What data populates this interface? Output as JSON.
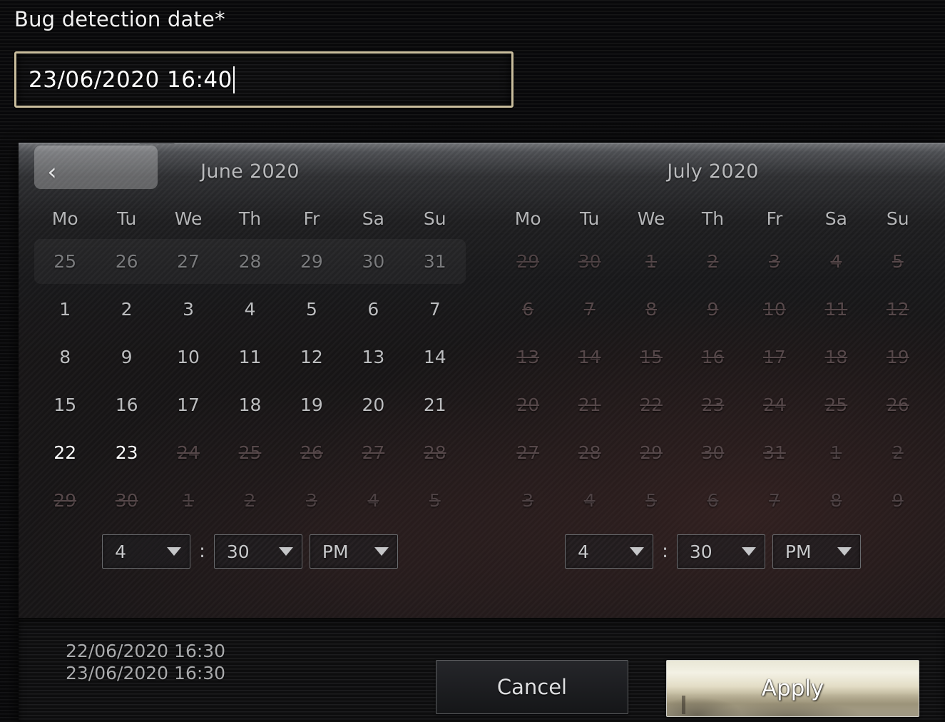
{
  "field": {
    "label": "Bug detection date*",
    "value": "23/06/2020 16:40"
  },
  "popup": {
    "prev_icon": "chevron-left-icon",
    "caret_icon": "chevron-up-icon",
    "months": [
      {
        "title": "June 2020",
        "weekdays": [
          "Mo",
          "Tu",
          "We",
          "Th",
          "Fr",
          "Sa",
          "Su"
        ],
        "weeks": [
          [
            {
              "d": "25",
              "state": "muted"
            },
            {
              "d": "26",
              "state": "muted"
            },
            {
              "d": "27",
              "state": "muted"
            },
            {
              "d": "28",
              "state": "muted"
            },
            {
              "d": "29",
              "state": "muted"
            },
            {
              "d": "30",
              "state": "muted"
            },
            {
              "d": "31",
              "state": "muted"
            }
          ],
          [
            {
              "d": "1",
              "state": "normal"
            },
            {
              "d": "2",
              "state": "normal"
            },
            {
              "d": "3",
              "state": "normal"
            },
            {
              "d": "4",
              "state": "normal"
            },
            {
              "d": "5",
              "state": "normal"
            },
            {
              "d": "6",
              "state": "normal"
            },
            {
              "d": "7",
              "state": "normal"
            }
          ],
          [
            {
              "d": "8",
              "state": "normal"
            },
            {
              "d": "9",
              "state": "normal"
            },
            {
              "d": "10",
              "state": "normal"
            },
            {
              "d": "11",
              "state": "normal"
            },
            {
              "d": "12",
              "state": "normal"
            },
            {
              "d": "13",
              "state": "normal"
            },
            {
              "d": "14",
              "state": "normal"
            }
          ],
          [
            {
              "d": "15",
              "state": "normal"
            },
            {
              "d": "16",
              "state": "normal"
            },
            {
              "d": "17",
              "state": "normal"
            },
            {
              "d": "18",
              "state": "normal"
            },
            {
              "d": "19",
              "state": "normal"
            },
            {
              "d": "20",
              "state": "normal"
            },
            {
              "d": "21",
              "state": "normal"
            }
          ],
          [
            {
              "d": "22",
              "state": "selected"
            },
            {
              "d": "23",
              "state": "selected"
            },
            {
              "d": "24",
              "state": "disabled"
            },
            {
              "d": "25",
              "state": "disabled"
            },
            {
              "d": "26",
              "state": "disabled"
            },
            {
              "d": "27",
              "state": "disabled"
            },
            {
              "d": "28",
              "state": "disabled"
            }
          ],
          [
            {
              "d": "29",
              "state": "disabled"
            },
            {
              "d": "30",
              "state": "disabled"
            },
            {
              "d": "1",
              "state": "muted-disabled"
            },
            {
              "d": "2",
              "state": "muted-disabled"
            },
            {
              "d": "3",
              "state": "muted-disabled"
            },
            {
              "d": "4",
              "state": "muted-disabled"
            },
            {
              "d": "5",
              "state": "muted-disabled"
            }
          ]
        ],
        "time": {
          "hour": "4",
          "separator": ":",
          "minute": "30",
          "period": "PM"
        }
      },
      {
        "title": "July 2020",
        "weekdays": [
          "Mo",
          "Tu",
          "We",
          "Th",
          "Fr",
          "Sa",
          "Su"
        ],
        "weeks": [
          [
            {
              "d": "29",
              "state": "muted-disabled"
            },
            {
              "d": "30",
              "state": "muted-disabled"
            },
            {
              "d": "1",
              "state": "disabled"
            },
            {
              "d": "2",
              "state": "disabled"
            },
            {
              "d": "3",
              "state": "disabled"
            },
            {
              "d": "4",
              "state": "disabled"
            },
            {
              "d": "5",
              "state": "disabled"
            }
          ],
          [
            {
              "d": "6",
              "state": "disabled"
            },
            {
              "d": "7",
              "state": "disabled"
            },
            {
              "d": "8",
              "state": "disabled"
            },
            {
              "d": "9",
              "state": "disabled"
            },
            {
              "d": "10",
              "state": "disabled"
            },
            {
              "d": "11",
              "state": "disabled"
            },
            {
              "d": "12",
              "state": "disabled"
            }
          ],
          [
            {
              "d": "13",
              "state": "disabled"
            },
            {
              "d": "14",
              "state": "disabled"
            },
            {
              "d": "15",
              "state": "disabled"
            },
            {
              "d": "16",
              "state": "disabled"
            },
            {
              "d": "17",
              "state": "disabled"
            },
            {
              "d": "18",
              "state": "disabled"
            },
            {
              "d": "19",
              "state": "disabled"
            }
          ],
          [
            {
              "d": "20",
              "state": "disabled"
            },
            {
              "d": "21",
              "state": "disabled"
            },
            {
              "d": "22",
              "state": "disabled"
            },
            {
              "d": "23",
              "state": "disabled"
            },
            {
              "d": "24",
              "state": "disabled"
            },
            {
              "d": "25",
              "state": "disabled"
            },
            {
              "d": "26",
              "state": "disabled"
            }
          ],
          [
            {
              "d": "27",
              "state": "disabled"
            },
            {
              "d": "28",
              "state": "disabled"
            },
            {
              "d": "29",
              "state": "disabled"
            },
            {
              "d": "30",
              "state": "disabled"
            },
            {
              "d": "31",
              "state": "disabled"
            },
            {
              "d": "1",
              "state": "muted-disabled"
            },
            {
              "d": "2",
              "state": "muted-disabled"
            }
          ],
          [
            {
              "d": "3",
              "state": "muted-disabled"
            },
            {
              "d": "4",
              "state": "muted-disabled"
            },
            {
              "d": "5",
              "state": "muted-disabled"
            },
            {
              "d": "6",
              "state": "muted-disabled"
            },
            {
              "d": "7",
              "state": "muted-disabled"
            },
            {
              "d": "8",
              "state": "muted-disabled"
            },
            {
              "d": "9",
              "state": "muted-disabled"
            }
          ]
        ],
        "time": {
          "hour": "4",
          "separator": ":",
          "minute": "30",
          "period": "PM"
        }
      }
    ],
    "footer": {
      "range_start": "22/06/2020 16:30",
      "range_end": "23/06/2020 16:30",
      "cancel_label": "Cancel",
      "apply_label": "Apply"
    }
  },
  "colors": {
    "input_border": "#c9bd9d",
    "apply_bg": "#e3ddc6",
    "selected_pill": "#ffffff44",
    "disabled_text": "#56484a"
  }
}
